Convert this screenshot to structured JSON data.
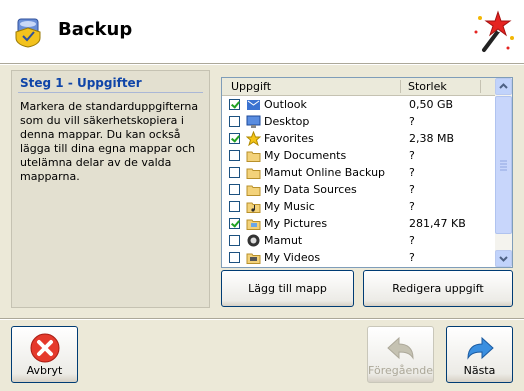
{
  "header": {
    "title": "Backup",
    "app_icon": "backup-shield-icon",
    "decoration": "magic-wand-icon"
  },
  "step": {
    "title": "Steg 1 - Uppgifter",
    "description": "Markera de standarduppgifterna som du vill säkerhetskopiera i denna mappar. Du kan också lägga till dina egna mappar och utelämna delar av de valda mapparna."
  },
  "list": {
    "columns": {
      "task": "Uppgift",
      "size": "Storlek"
    },
    "rows": [
      {
        "name": "Outlook",
        "size": "0,50 GB",
        "checked": true,
        "icon": "outlook-icon"
      },
      {
        "name": "Desktop",
        "size": "?",
        "checked": false,
        "icon": "desktop-icon"
      },
      {
        "name": "Favorites",
        "size": "2,38 MB",
        "checked": true,
        "icon": "favorites-star-icon"
      },
      {
        "name": "My Documents",
        "size": "?",
        "checked": false,
        "icon": "folder-icon"
      },
      {
        "name": "Mamut Online Backup",
        "size": "?",
        "checked": false,
        "icon": "folder-icon"
      },
      {
        "name": "My Data Sources",
        "size": "?",
        "checked": false,
        "icon": "folder-icon"
      },
      {
        "name": "My Music",
        "size": "?",
        "checked": false,
        "icon": "folder-music-icon"
      },
      {
        "name": "My Pictures",
        "size": "281,47 KB",
        "checked": true,
        "icon": "folder-pictures-icon"
      },
      {
        "name": "Mamut",
        "size": "?",
        "checked": false,
        "icon": "mamut-icon"
      },
      {
        "name": "My Videos",
        "size": "?",
        "checked": false,
        "icon": "folder-video-icon"
      }
    ]
  },
  "buttons": {
    "add_folder": "Lägg till mapp",
    "edit_task": "Redigera uppgift",
    "cancel": "Avbryt",
    "previous": "Föregående",
    "next": "Nästa"
  },
  "colors": {
    "accent": "#0f45a8",
    "border": "#003c74",
    "background": "#ece9d8"
  }
}
